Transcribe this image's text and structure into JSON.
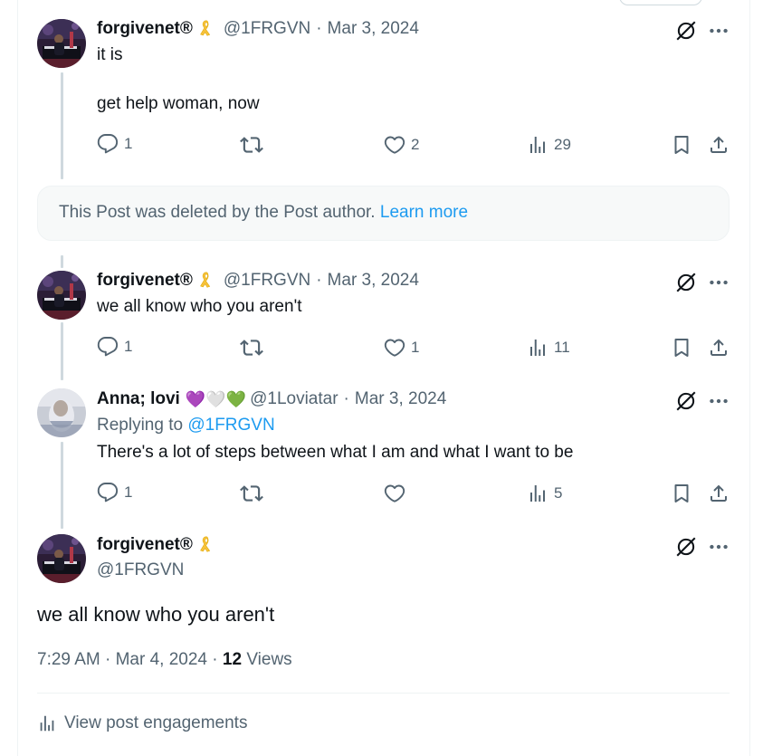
{
  "posts": [
    {
      "name": "forgivenet®",
      "handle": "@1FRGVN",
      "separator": "·",
      "date": "Mar 3, 2024",
      "lines": [
        "it is",
        "get help woman, now"
      ],
      "replies": "1",
      "reposts": "",
      "likes": "2",
      "views": "29"
    },
    {
      "name": "forgivenet®",
      "handle": "@1FRGVN",
      "separator": "·",
      "date": "Mar 3, 2024",
      "lines": [
        "we all know who you aren't"
      ],
      "replies": "1",
      "reposts": "",
      "likes": "1",
      "views": "11"
    },
    {
      "name": "Anna; lovi",
      "hearts": "💜🤍💚",
      "handle": "@1Loviatar",
      "separator": "·",
      "date": "Mar 3, 2024",
      "replying_label": "Replying to",
      "replying_handle": "@1FRGVN",
      "lines": [
        "There's a lot of steps between what I am and what I want to be"
      ],
      "replies": "1",
      "reposts": "",
      "likes": "",
      "views": "5"
    }
  ],
  "deleted": {
    "message": "This Post was deleted by the Post author.",
    "link": "Learn more"
  },
  "main_post": {
    "name": "forgivenet®",
    "handle": "@1FRGVN",
    "text": "we all know who you aren't",
    "time": "7:29 AM",
    "separator": "·",
    "date": "Mar 4, 2024",
    "views_count": "12",
    "views_label": "Views",
    "engagements_label": "View post engagements"
  },
  "icons": [
    "ribbon-icon",
    "grok-icon",
    "more-icon",
    "reply-icon",
    "repost-icon",
    "like-icon",
    "views-icon",
    "bookmark-icon",
    "share-icon"
  ],
  "colors": {
    "text": "#0f1419",
    "muted": "#536471",
    "link": "#1d9bf0",
    "ribbon": "#f7c23c",
    "line": "#cfd9de"
  }
}
